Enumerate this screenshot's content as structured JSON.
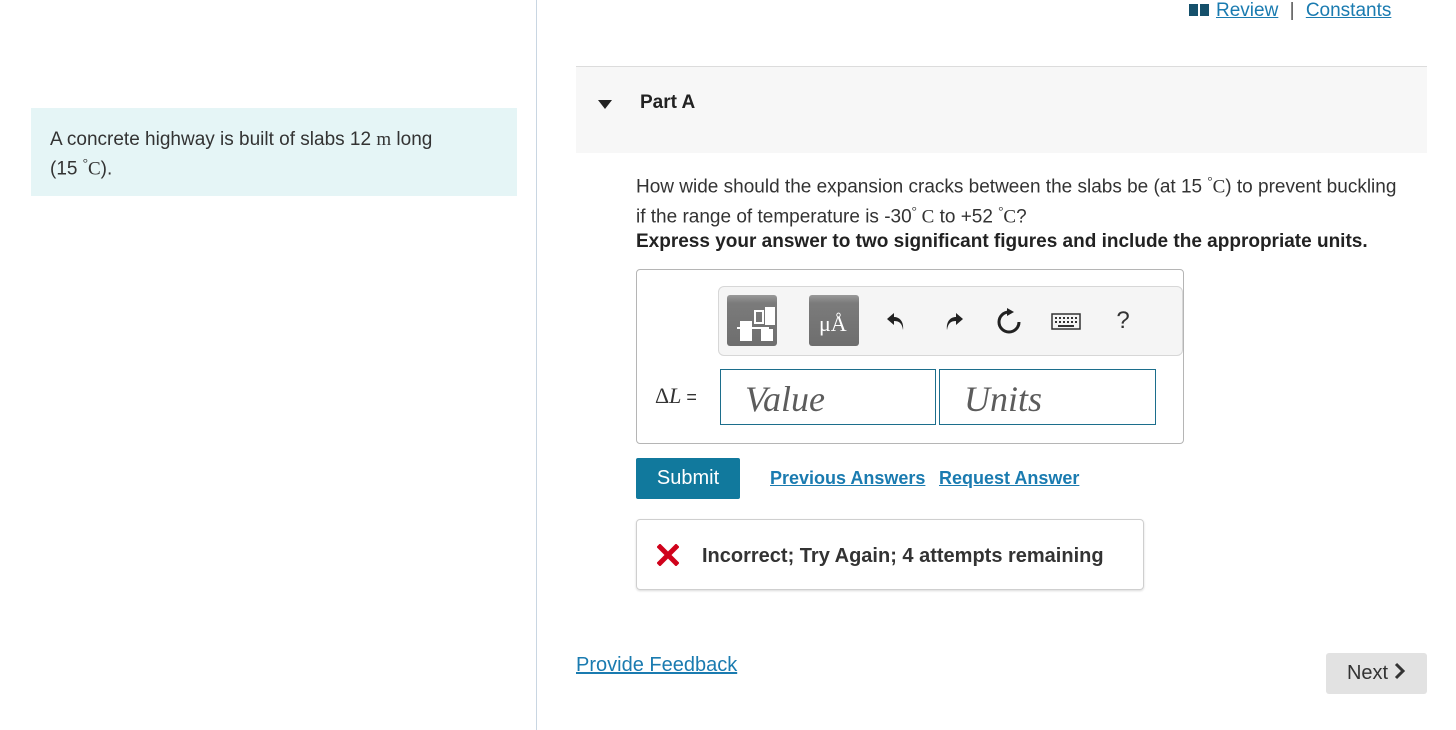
{
  "top_links": {
    "review": "Review",
    "separator": "|",
    "constants": "Constants"
  },
  "problem": {
    "text_a": "A concrete highway is built of slabs 12 ",
    "unit_m": "m",
    "text_b": " long",
    "text_c": "(15 ",
    "deg": "°",
    "unit_c": "C",
    "text_d": ")."
  },
  "part": {
    "title": "Part A"
  },
  "question": {
    "text_a": "How wide should the expansion cracks between the slabs be (at 15 ",
    "deg": "°",
    "unit_c": "C",
    "text_b": ") to prevent buckling",
    "text_c": "if the range of temperature is -30",
    "deg2": "°",
    "unit_c2": " C",
    "text_d": " to +52 ",
    "deg3": "°",
    "unit_c3": "C",
    "text_e": "?"
  },
  "instruction": "Express your answer to two significant figures and include the appropriate units.",
  "toolbar": {
    "units_button": "μÅ",
    "help": "?",
    "icons": [
      "templates-icon",
      "units-icon",
      "undo-icon",
      "redo-icon",
      "reset-icon",
      "keyboard-icon",
      "help-icon"
    ]
  },
  "answer": {
    "delta": "Δ",
    "var": "L",
    "equals": " =",
    "value_placeholder": "Value",
    "units_placeholder": "Units"
  },
  "actions": {
    "submit": "Submit",
    "previous_answers": "Previous Answers",
    "request_answer": "Request Answer"
  },
  "feedback": {
    "status": "Incorrect; Try Again; 4 attempts remaining",
    "icon": "x-icon",
    "color": "#d0021b"
  },
  "footer": {
    "provide_feedback": "Provide Feedback",
    "next": "Next"
  },
  "colors": {
    "accent": "#11799d",
    "link": "#1a7bb0",
    "problem_bg": "#e5f5f6"
  }
}
